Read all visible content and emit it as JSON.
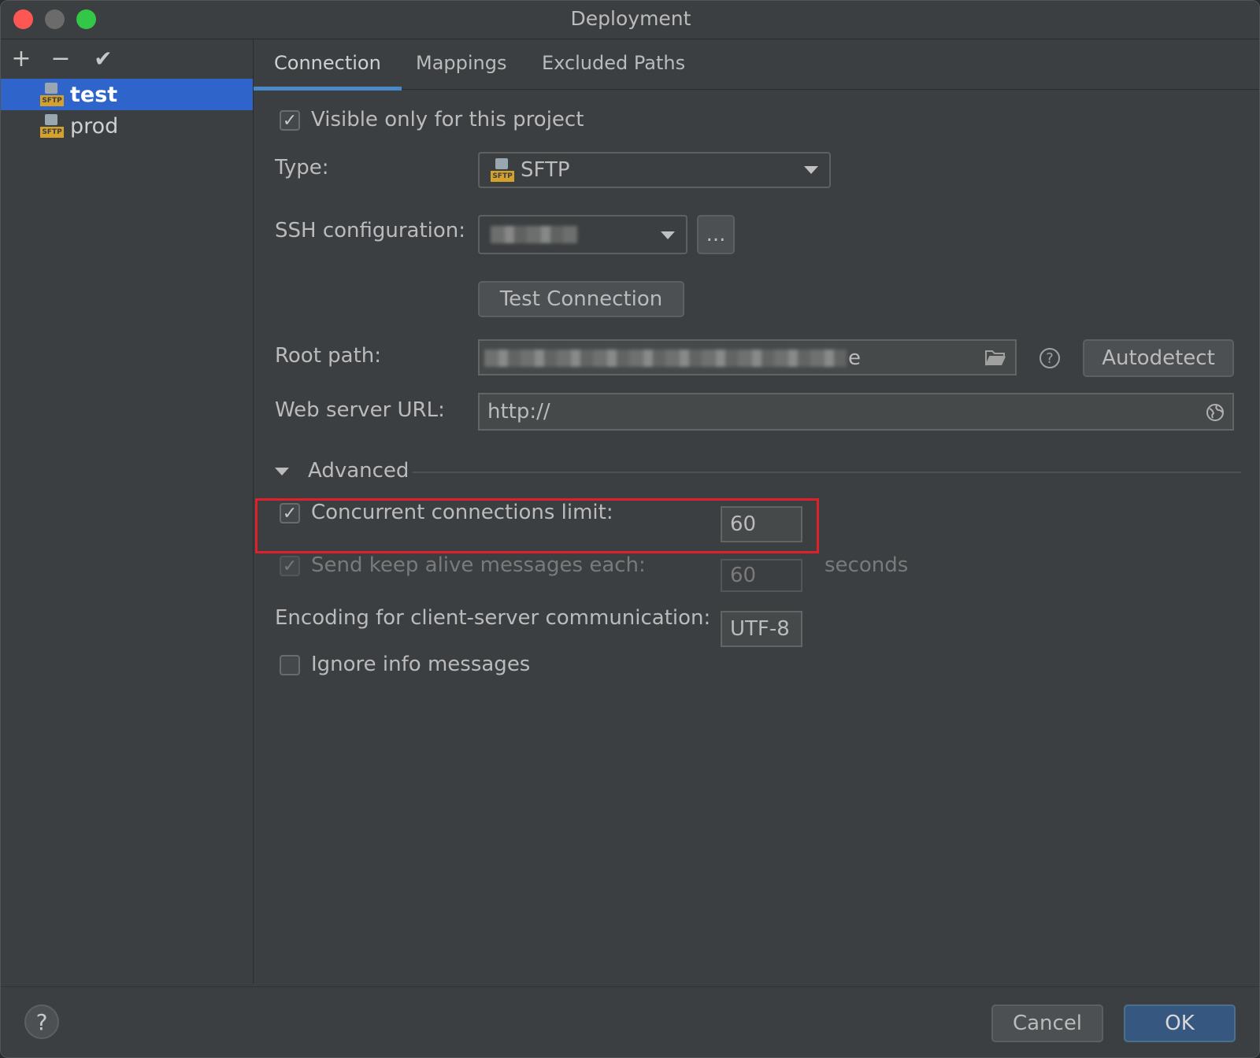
{
  "window": {
    "title": "Deployment"
  },
  "left_panel": {
    "tools": [
      {
        "icon": "plus-icon",
        "glyph": "+"
      },
      {
        "icon": "minus-icon",
        "glyph": "−"
      },
      {
        "icon": "check-icon",
        "glyph": "✔"
      }
    ],
    "servers": [
      {
        "name": "test",
        "icon_label": "SFTP",
        "selected": true
      },
      {
        "name": "prod",
        "icon_label": "SFTP",
        "selected": false
      }
    ]
  },
  "tabs": [
    {
      "label": "Connection",
      "active": true
    },
    {
      "label": "Mappings",
      "active": false
    },
    {
      "label": "Excluded Paths",
      "active": false
    }
  ],
  "connection": {
    "visible_only": {
      "label": "Visible only for this project",
      "checked": true
    },
    "type": {
      "label": "Type:",
      "value": "SFTP",
      "icon_label": "SFTP"
    },
    "ssh": {
      "label": "SSH configuration:",
      "browse_label": "..."
    },
    "test_connection_label": "Test Connection",
    "root_path": {
      "label": "Root path:",
      "visible_fragment": "e",
      "autodetect_label": "Autodetect",
      "help_glyph": "?"
    },
    "web_server_url": {
      "label": "Web server URL:",
      "value": "http://"
    }
  },
  "advanced": {
    "title": "Advanced",
    "concurrent": {
      "label": "Concurrent connections limit:",
      "checked": true,
      "value": "60"
    },
    "keep_alive": {
      "label": "Send keep alive messages each:",
      "checked": true,
      "value": "60",
      "unit": "seconds"
    },
    "encoding": {
      "label": "Encoding for client-server communication:",
      "value": "UTF-8"
    },
    "ignore_info": {
      "label": "Ignore info messages",
      "checked": false
    }
  },
  "footer": {
    "help_glyph": "?",
    "cancel_label": "Cancel",
    "ok_label": "OK"
  },
  "colors": {
    "accent": "#2f65ca",
    "highlight": "#e0202a",
    "primary_button": "#365880"
  }
}
